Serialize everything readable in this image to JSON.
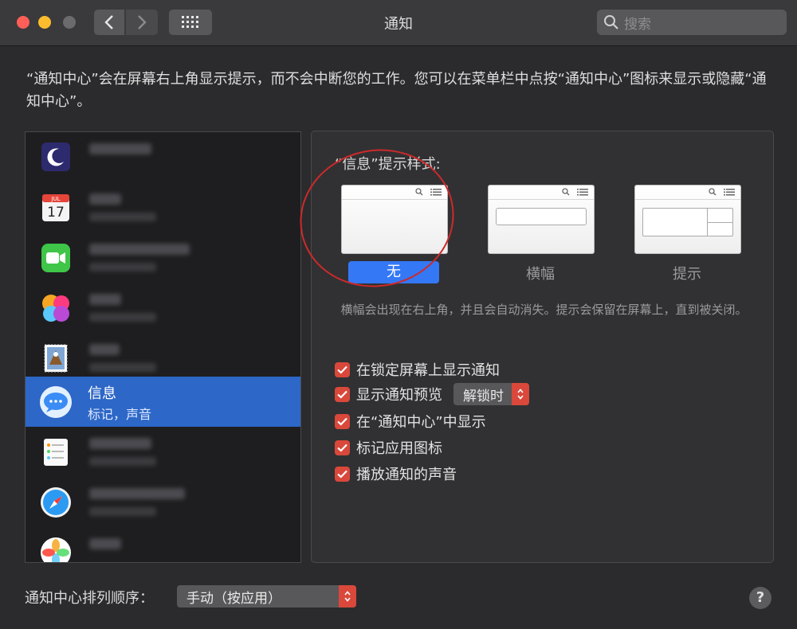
{
  "window": {
    "title": "通知",
    "search_placeholder": "搜索"
  },
  "description": "“通知中心”会在屏幕右上角显示提示，而不会中断您的工作。您可以在菜单栏中点按“通知中心”图标来显示或隐藏“通知中心”。",
  "app_list": {
    "items": [
      {
        "icon": "moon-icon",
        "blurred": true
      },
      {
        "icon": "calendar-icon",
        "blurred": true,
        "calendar_month": "JUL",
        "calendar_day": "17"
      },
      {
        "icon": "facetime-icon",
        "blurred": true
      },
      {
        "icon": "game-center-icon",
        "blurred": true
      },
      {
        "icon": "mail-stamp-icon",
        "blurred": true
      },
      {
        "icon": "messages-icon",
        "name": "信息",
        "subtitle": "标记，声音",
        "selected": true
      },
      {
        "icon": "reminders-icon",
        "blurred": true
      },
      {
        "icon": "safari-icon",
        "blurred": true
      },
      {
        "icon": "photos-icon",
        "blurred": true
      }
    ]
  },
  "alert_style": {
    "title": "“信息”提示样式:",
    "options": [
      {
        "label": "无",
        "selected": true
      },
      {
        "label": "横幅",
        "selected": false
      },
      {
        "label": "提示",
        "selected": false
      }
    ],
    "hint": "横幅会出现在右上角，并且会自动消失。提示会保留在屏幕上，直到被关闭。"
  },
  "options": {
    "lock_screen": "在锁定屏幕上显示通知",
    "preview": "显示通知预览",
    "preview_value": "解锁时",
    "in_center": "在“通知中心”中显示",
    "badge": "标记应用图标",
    "sound": "播放通知的声音"
  },
  "footer": {
    "order_label": "通知中心排列顺序：",
    "order_value": "手动（按应用）",
    "help": "?"
  },
  "colors": {
    "selection_blue": "#2d67c7",
    "checkbox_red": "#d9483b",
    "annotation_circle": "#cc2a2a"
  }
}
